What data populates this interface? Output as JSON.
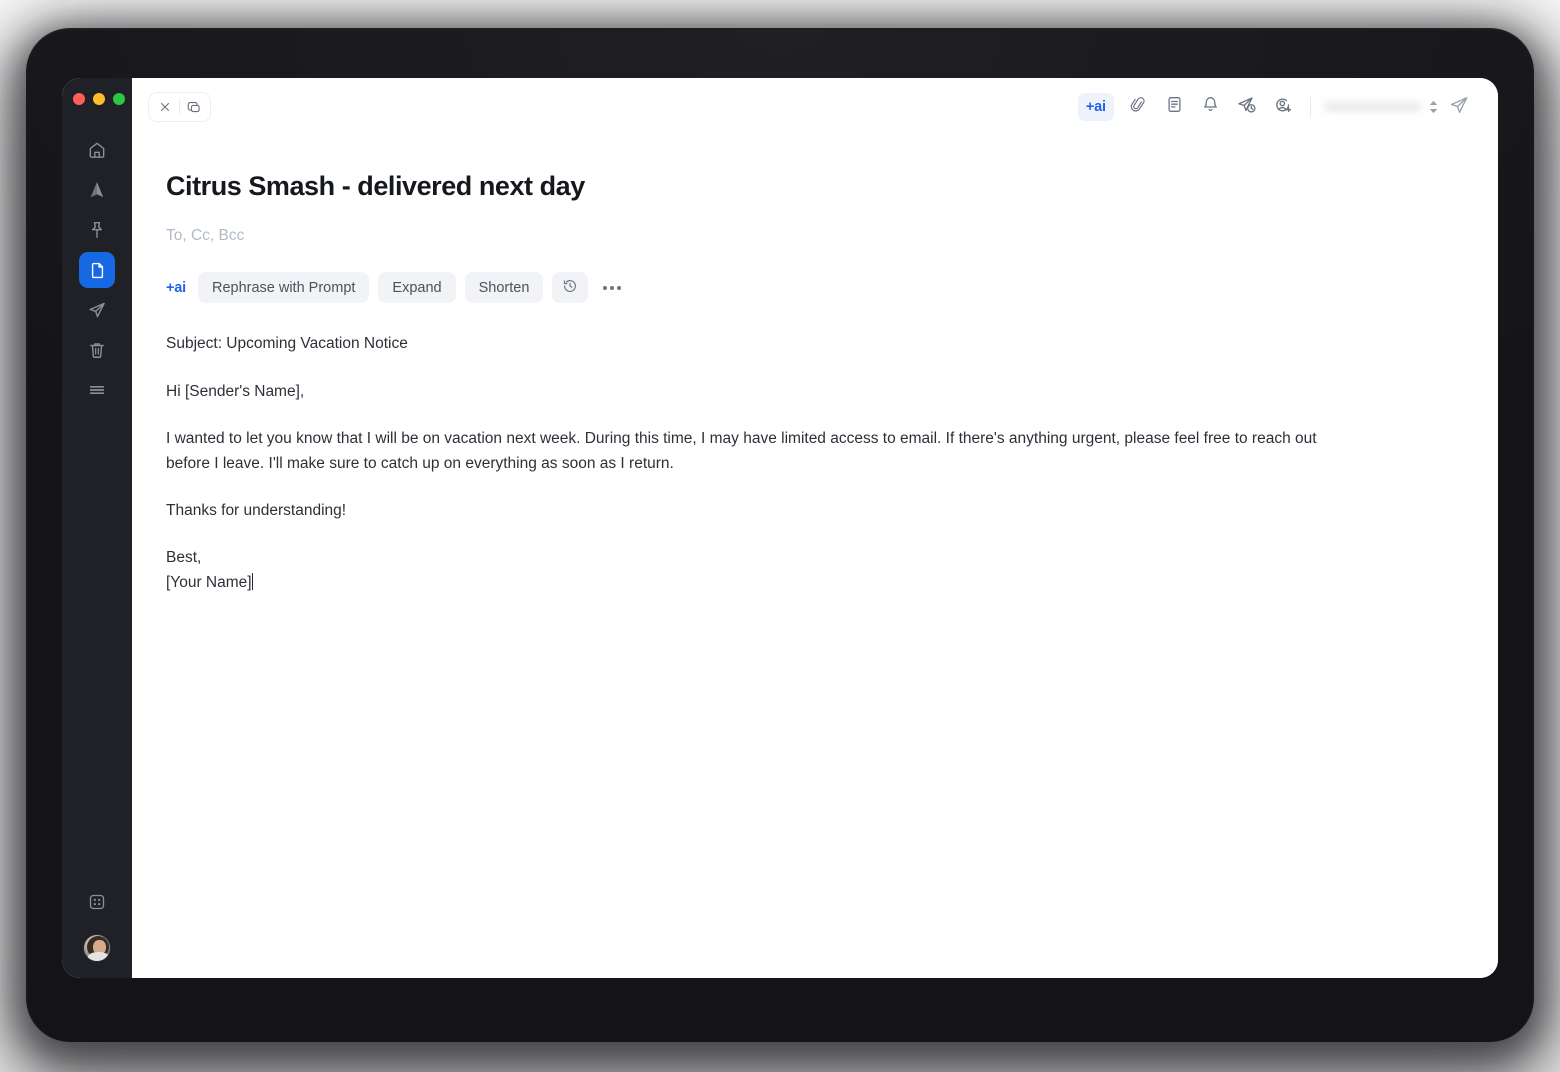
{
  "window": {
    "traffic_lights": [
      "close",
      "minimize",
      "maximize"
    ],
    "close_label": "",
    "popout_label": ""
  },
  "sidebar": {
    "items": [
      {
        "id": "home",
        "icon": "home-icon",
        "label": "Home",
        "active": false
      },
      {
        "id": "boosts",
        "icon": "send-filled-icon",
        "label": "Boost",
        "active": false
      },
      {
        "id": "pinned",
        "icon": "pin-icon",
        "label": "Pinned",
        "active": false
      },
      {
        "id": "drafts",
        "icon": "document-icon",
        "label": "Drafts",
        "active": true
      },
      {
        "id": "sent",
        "icon": "send-icon",
        "label": "Sent",
        "active": false
      },
      {
        "id": "trash",
        "icon": "trash-icon",
        "label": "Trash",
        "active": false
      },
      {
        "id": "more",
        "icon": "menu-icon",
        "label": "More",
        "active": false
      }
    ],
    "bottom": [
      {
        "id": "apps",
        "icon": "apps-grid-icon",
        "label": "Apps"
      },
      {
        "id": "avatar",
        "icon": "avatar",
        "label": "Account"
      }
    ],
    "active_color": "#1668e3",
    "background_color": "#1f2126"
  },
  "toolbar": {
    "ai_chip_label": "+ai",
    "icons": [
      {
        "id": "attach",
        "icon": "paperclip-icon",
        "label": "Attach file"
      },
      {
        "id": "template",
        "icon": "template-icon",
        "label": "Templates"
      },
      {
        "id": "reminder",
        "icon": "bell-icon",
        "label": "Remind me"
      },
      {
        "id": "send-later",
        "icon": "send-later-icon",
        "label": "Send later"
      },
      {
        "id": "add-contact",
        "icon": "add-contact-icon",
        "label": "Add contact"
      }
    ],
    "account_email": "•••••••••••••••••••••",
    "send_label": "Send"
  },
  "compose": {
    "title": "Citrus Smash - delivered next day",
    "recipients_placeholder": "To, Cc, Bcc",
    "recipients_value": "",
    "ai_bar": {
      "label": "+ai",
      "buttons": [
        {
          "id": "rephrase",
          "label": "Rephrase with Prompt"
        },
        {
          "id": "expand",
          "label": "Expand"
        },
        {
          "id": "shorten",
          "label": "Shorten"
        }
      ],
      "history_icon": "history-clock-icon",
      "more_icon": "more-horizontal-icon"
    },
    "body": {
      "subject_line": "Subject: Upcoming Vacation Notice",
      "greeting": "Hi [Sender's Name],",
      "paragraph": "I wanted to let you know that I will be on vacation next week. During this time, I may have limited access to email. If there's anything urgent, please feel free to reach out before I leave. I'll make sure to catch up on everything as soon as I return.",
      "thanks": "Thanks for understanding!",
      "sign_off": "Best,",
      "signature": "[Your Name]"
    }
  },
  "colors": {
    "accent_blue": "#2563eb",
    "active_nav_blue": "#1668e3",
    "sidebar_bg": "#1f2126",
    "body_text": "#2c3138",
    "placeholder": "#b3bac4",
    "chip_bg": "#f1f3f6"
  }
}
